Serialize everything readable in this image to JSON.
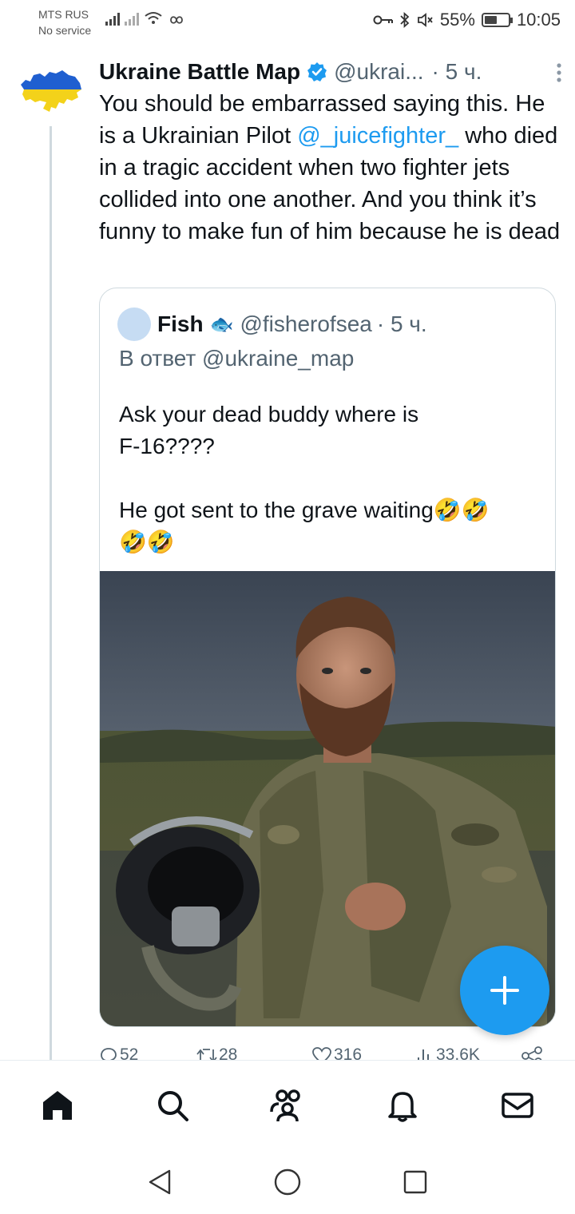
{
  "status_bar": {
    "carrier_name": "MTS RUS",
    "carrier_status": "No service",
    "battery_percent_label": "55%",
    "battery_level": 0.55,
    "time": "10:05"
  },
  "tweet": {
    "author": "Ukraine Battle Map",
    "handle": "@ukrai...",
    "time": "· 5 ч.",
    "text_parts": {
      "before_mention": "You should be embarrassed saying this. He is a Ukrainian Pilot ",
      "mention": "@_juicefighter_",
      "after_mention": " who died in a tragic accident when two fighter jets collided into one another. And you think it’s funny to make fun of him because he is dead"
    },
    "icons": {
      "avatar": "ukraine-map-flag-icon",
      "verified": "verified-badge-icon",
      "more": "more-options-icon"
    }
  },
  "quoted_tweet": {
    "author": "Fish",
    "author_emoji": "🐟",
    "handle": "@fisherofsea",
    "time": "· 5 ч.",
    "reply_to": "В ответ @ukraine_map",
    "lines": [
      "Ask your dead buddy where is",
      "F-16????",
      "",
      "He got sent to the grave waiting🤣🤣",
      "🤣🤣"
    ],
    "photo": "pilot-photo"
  },
  "actions": {
    "replies": "52",
    "reposts": "28",
    "likes": "316",
    "views": "33,6K"
  },
  "colors": {
    "accent": "#1d9bf0",
    "text": "#0f1419",
    "muted": "#536471",
    "border": "#cfd9de"
  },
  "bottom_nav": [
    "home-icon",
    "search-icon",
    "communities-icon",
    "notifications-icon",
    "messages-icon"
  ],
  "system_nav": [
    "back-icon",
    "home-circle-icon",
    "recents-icon"
  ]
}
